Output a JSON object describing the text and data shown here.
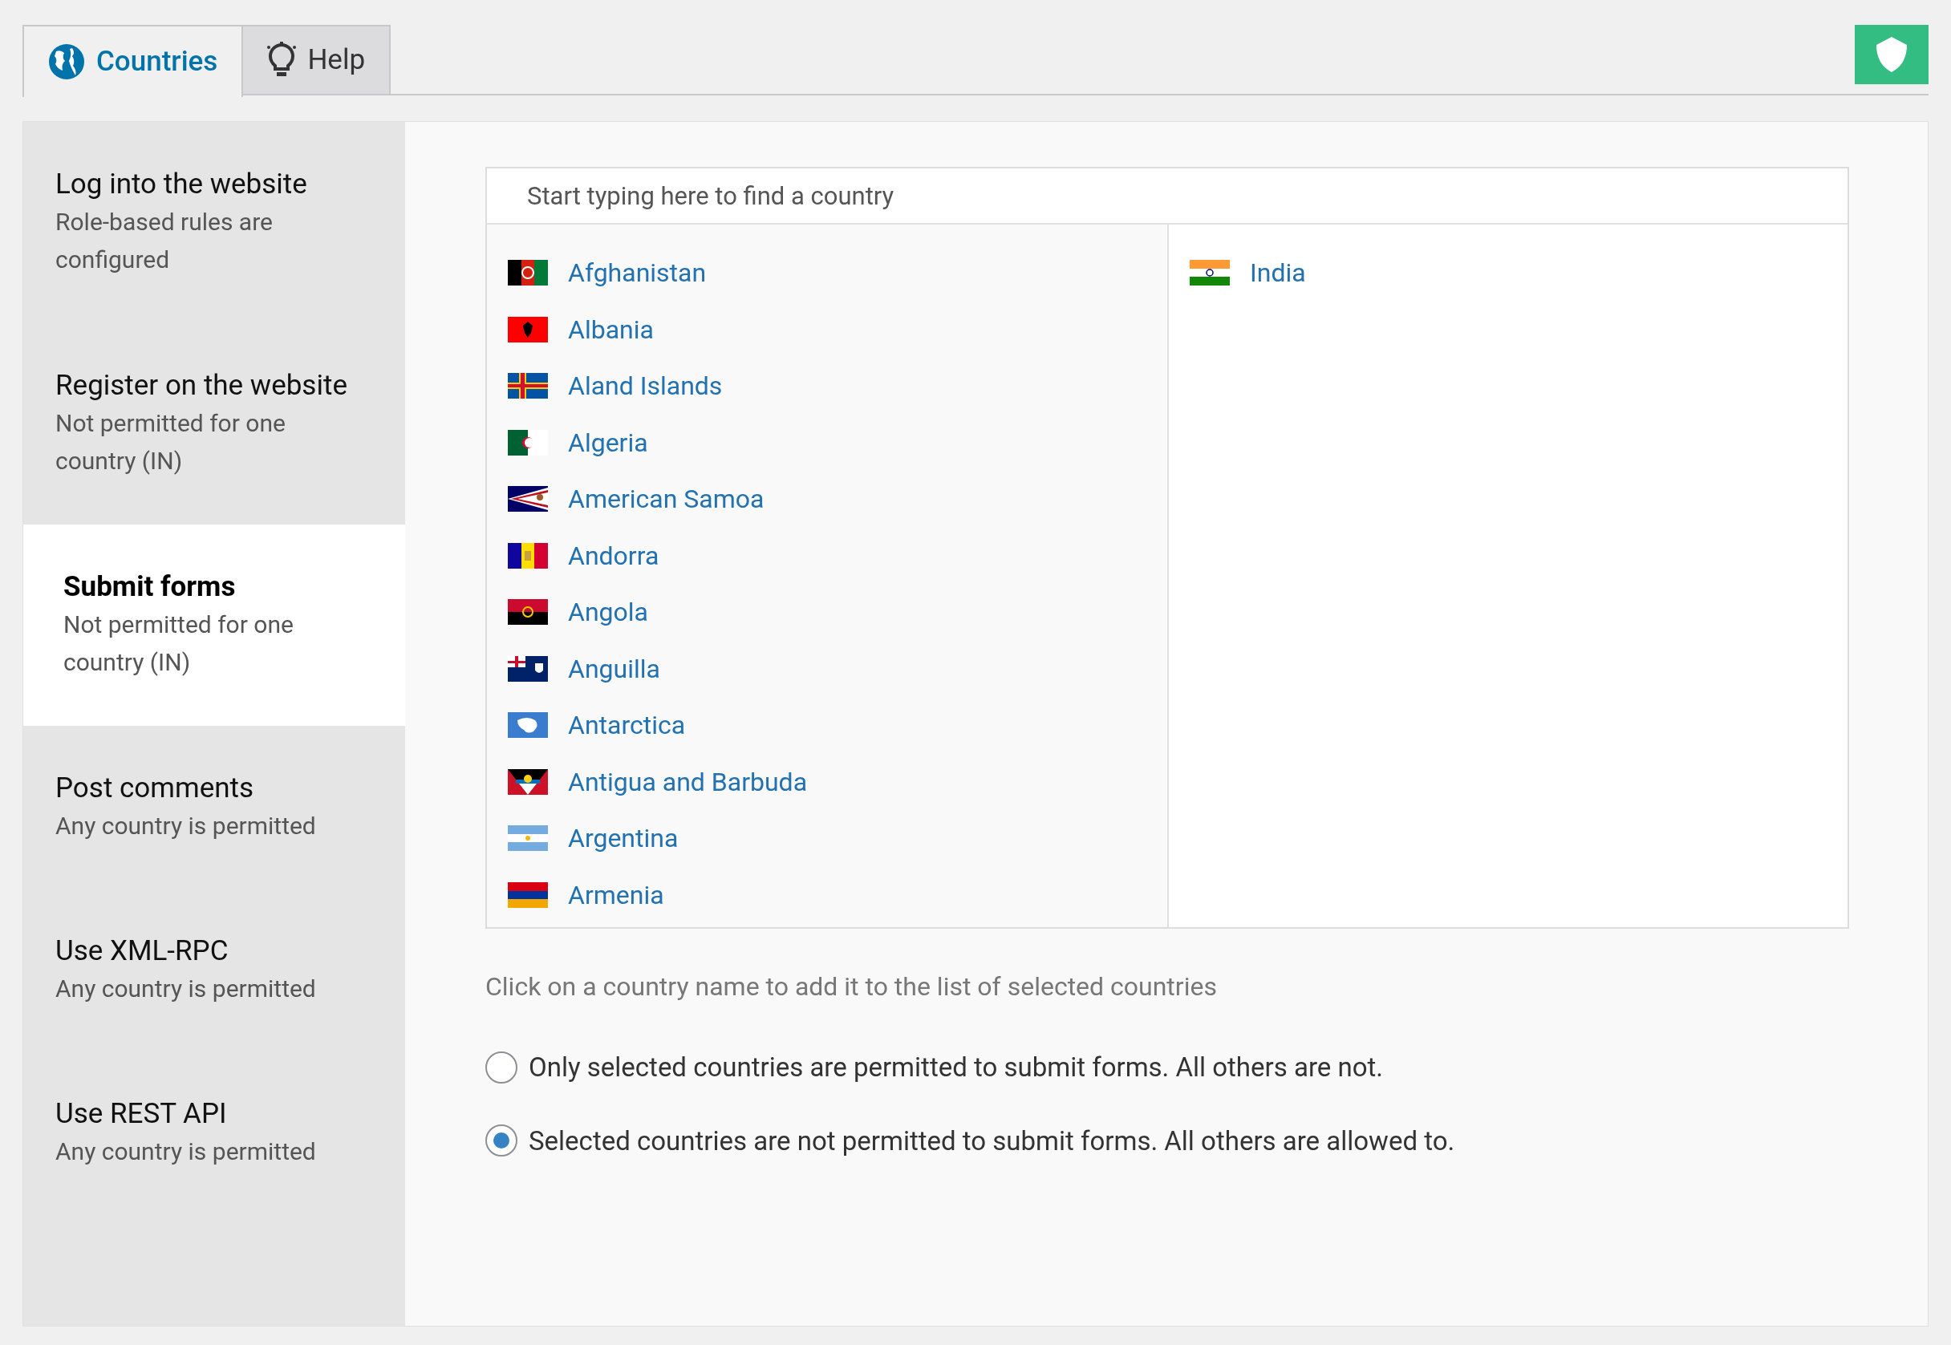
{
  "tabs": [
    {
      "label": "Countries",
      "selected": true
    },
    {
      "label": "Help",
      "selected": false
    }
  ],
  "sidebar": {
    "items": [
      {
        "title": "Log into the website",
        "description": "Role-based rules are configured",
        "selected": false
      },
      {
        "title": "Register on the website",
        "description": "Not permitted for one country (IN)",
        "selected": false
      },
      {
        "title": "Submit forms",
        "description": "Not permitted for one country (IN)",
        "selected": true
      },
      {
        "title": "Post comments",
        "description": "Any country is permitted",
        "selected": false
      },
      {
        "title": "Use XML-RPC",
        "description": "Any country is permitted",
        "selected": false
      },
      {
        "title": "Use REST API",
        "description": "Any country is permitted",
        "selected": false
      }
    ]
  },
  "search": {
    "placeholder": "Start typing here to find a country"
  },
  "available_countries": [
    "Afghanistan",
    "Albania",
    "Aland Islands",
    "Algeria",
    "American Samoa",
    "Andorra",
    "Angola",
    "Anguilla",
    "Antarctica",
    "Antigua and Barbuda",
    "Argentina",
    "Armenia"
  ],
  "selected_countries": [
    "India"
  ],
  "hint": "Click on a country name to add it to the list of selected countries",
  "options": [
    {
      "label": "Only selected countries are permitted to submit forms. All others are not.",
      "selected": false
    },
    {
      "label": "Selected countries are not permitted to submit forms. All others are allowed to.",
      "selected": true
    }
  ]
}
